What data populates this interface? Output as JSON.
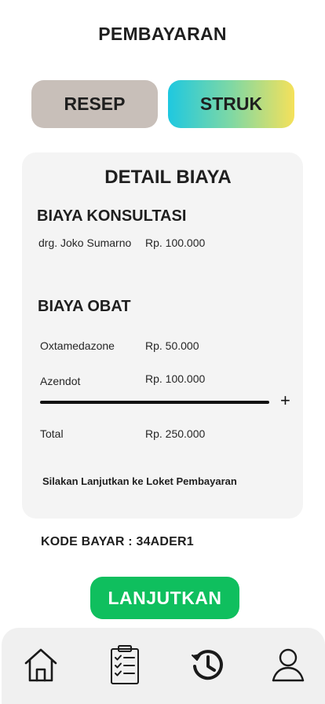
{
  "header": {
    "title": "PEMBAYARAN"
  },
  "tabs": [
    {
      "label": "RESEP"
    },
    {
      "label": "STRUK"
    }
  ],
  "detail": {
    "title": "DETAIL BIAYA",
    "konsultasi": {
      "title": "BIAYA KONSULTASI",
      "label": "drg. Joko Sumarno",
      "value": "Rp. 100.000"
    },
    "obat": {
      "title": "BIAYA OBAT",
      "items": [
        {
          "label": "Oxtamedazone",
          "value": "Rp.  50.000"
        },
        {
          "label": "Azendot",
          "value": "Rp.  100.000"
        }
      ]
    },
    "plus_sign": "+",
    "total": {
      "label": "Total",
      "value": "Rp. 250.000"
    },
    "note": "Silakan Lanjutkan ke Loket Pembayaran"
  },
  "payment": {
    "label": "KODE BAYAR :",
    "code": "34ADER1"
  },
  "continue_label": "LANJUTKAN",
  "nav": [
    "home-icon",
    "checklist-icon",
    "history-icon",
    "profile-icon"
  ],
  "colors": {
    "accent_green": "#0fbf5e",
    "tab_resep": "#c8bfb9",
    "tab_struk_gradient": [
      "#1ec8e0",
      "#f5e15a"
    ],
    "card_bg": "#f4f4f4"
  }
}
